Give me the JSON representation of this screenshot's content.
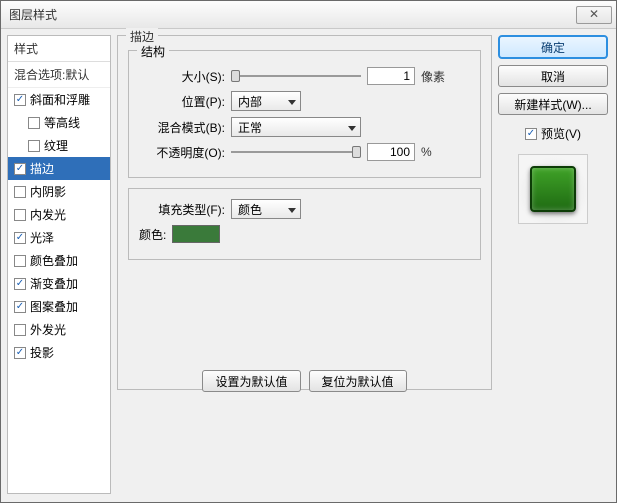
{
  "window": {
    "title": "图层样式"
  },
  "sidebar": {
    "header": "样式",
    "blend_options": "混合选项:默认",
    "items": [
      {
        "label": "斜面和浮雕",
        "checked": true,
        "selected": false,
        "indent": false
      },
      {
        "label": "等高线",
        "checked": false,
        "selected": false,
        "indent": true
      },
      {
        "label": "纹理",
        "checked": false,
        "selected": false,
        "indent": true
      },
      {
        "label": "描边",
        "checked": true,
        "selected": true,
        "indent": false
      },
      {
        "label": "内阴影",
        "checked": false,
        "selected": false,
        "indent": false
      },
      {
        "label": "内发光",
        "checked": false,
        "selected": false,
        "indent": false
      },
      {
        "label": "光泽",
        "checked": true,
        "selected": false,
        "indent": false
      },
      {
        "label": "颜色叠加",
        "checked": false,
        "selected": false,
        "indent": false
      },
      {
        "label": "渐变叠加",
        "checked": true,
        "selected": false,
        "indent": false
      },
      {
        "label": "图案叠加",
        "checked": true,
        "selected": false,
        "indent": false
      },
      {
        "label": "外发光",
        "checked": false,
        "selected": false,
        "indent": false
      },
      {
        "label": "投影",
        "checked": true,
        "selected": false,
        "indent": false
      }
    ]
  },
  "stroke": {
    "group_title": "描边",
    "structure_title": "结构",
    "size_label": "大小(S):",
    "size_value": "1",
    "size_unit": "像素",
    "position_label": "位置(P):",
    "position_value": "内部",
    "blend_label": "混合模式(B):",
    "blend_value": "正常",
    "opacity_label": "不透明度(O):",
    "opacity_value": "100",
    "opacity_unit": "%",
    "fill_type_label": "填充类型(F):",
    "fill_type_value": "颜色",
    "color_label": "颜色:",
    "color_value": "#3a7a3a",
    "reset_default": "设置为默认值",
    "revert_default": "复位为默认值"
  },
  "actions": {
    "ok": "确定",
    "cancel": "取消",
    "new_style": "新建样式(W)...",
    "preview_label": "预览(V)"
  }
}
